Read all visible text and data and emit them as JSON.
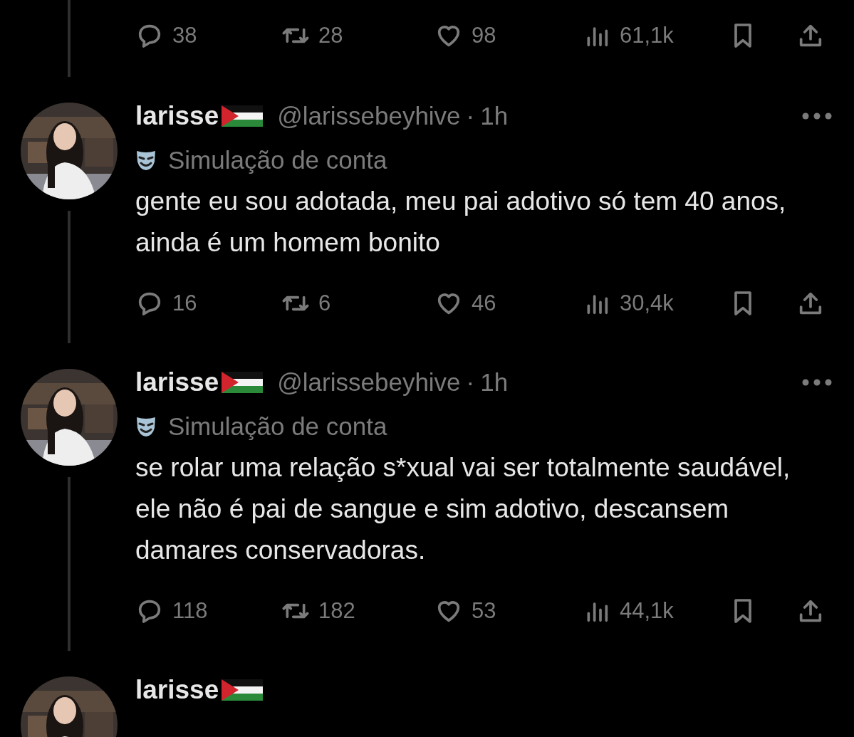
{
  "previous_tweet": {
    "actions": {
      "replies": "38",
      "reposts": "28",
      "likes": "98",
      "views": "61,1k"
    }
  },
  "tweets": [
    {
      "name": "larisse",
      "handle": "@larissebeyhive",
      "dot": "·",
      "time": "1h",
      "label": "Simulação de conta",
      "text": "gente eu sou adotada, meu pai adotivo só tem 40 anos, ainda é um homem bonito",
      "actions": {
        "replies": "16",
        "reposts": "6",
        "likes": "46",
        "views": "30,4k"
      }
    },
    {
      "name": "larisse",
      "handle": "@larissebeyhive",
      "dot": "·",
      "time": "1h",
      "label": "Simulação de conta",
      "text": "se rolar uma relação s*xual vai ser totalmente saudável, ele não é pai de sangue e sim adotivo, descansem damares conservadoras.",
      "actions": {
        "replies": "118",
        "reposts": "182",
        "likes": "53",
        "views": "44,1k"
      }
    },
    {
      "name": "larisse"
    }
  ]
}
